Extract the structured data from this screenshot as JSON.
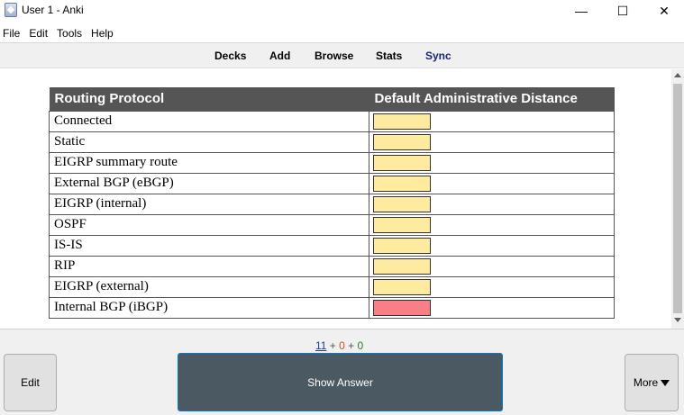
{
  "window": {
    "title": "User 1 - Anki",
    "minimize": "—",
    "maximize": "☐",
    "close": "✕"
  },
  "menu": [
    "File",
    "Edit",
    "Tools",
    "Help"
  ],
  "toolbar": {
    "decks": "Decks",
    "add": "Add",
    "browse": "Browse",
    "stats": "Stats",
    "sync": "Sync",
    "sync_color": "#1a237e"
  },
  "card": {
    "headers": [
      "Routing Protocol",
      "Default Administrative Distance"
    ],
    "rows": [
      {
        "protocol": "Connected",
        "highlight": false
      },
      {
        "protocol": "Static",
        "highlight": false
      },
      {
        "protocol": "EIGRP summary route",
        "highlight": false
      },
      {
        "protocol": "External BGP (eBGP)",
        "highlight": false
      },
      {
        "protocol": "EIGRP (internal)",
        "highlight": false
      },
      {
        "protocol": "OSPF",
        "highlight": false
      },
      {
        "protocol": "IS-IS",
        "highlight": false
      },
      {
        "protocol": "RIP",
        "highlight": false
      },
      {
        "protocol": "EIGRP (external)",
        "highlight": false
      },
      {
        "protocol": "Internal BGP (iBGP)",
        "highlight": true
      }
    ],
    "box_color": "#ffeba0",
    "highlight_color": "#f77f85"
  },
  "counts": {
    "new": "11",
    "plus1": " + ",
    "learn": "0",
    "plus2": " + ",
    "review": "0"
  },
  "buttons": {
    "edit": "Edit",
    "show_answer": "Show Answer",
    "more": "More"
  }
}
